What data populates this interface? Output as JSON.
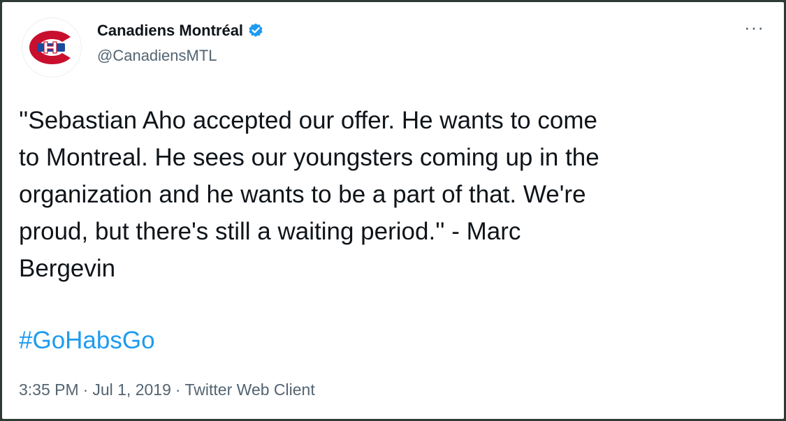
{
  "author": {
    "display_name": "Canadiens Montréal",
    "handle": "@CanadiensMTL",
    "verified": true
  },
  "icons": {
    "avatar": "canadiens-logo",
    "verified": "verified-badge-icon",
    "more": "more-options-icon"
  },
  "more_label": "···",
  "tweet": {
    "text": "''Sebastian Aho accepted our offer. He wants to come\nto Montreal. He sees our youngsters coming up in the\norganization and he wants to be a part of that. We're\nproud, but there's still a waiting period.'' - Marc\nBergevin",
    "hashtag": "#GoHabsGo"
  },
  "meta": {
    "time": "3:35 PM",
    "date": "Jul 1, 2019",
    "source": "Twitter Web Client",
    "separator": "·"
  },
  "colors": {
    "link": "#1d9bf0",
    "secondary_text": "#536471",
    "primary_text": "#0f1419",
    "logo_red": "#c8102e",
    "logo_blue": "#1d4a9c",
    "verified_blue": "#1d9bf0"
  }
}
